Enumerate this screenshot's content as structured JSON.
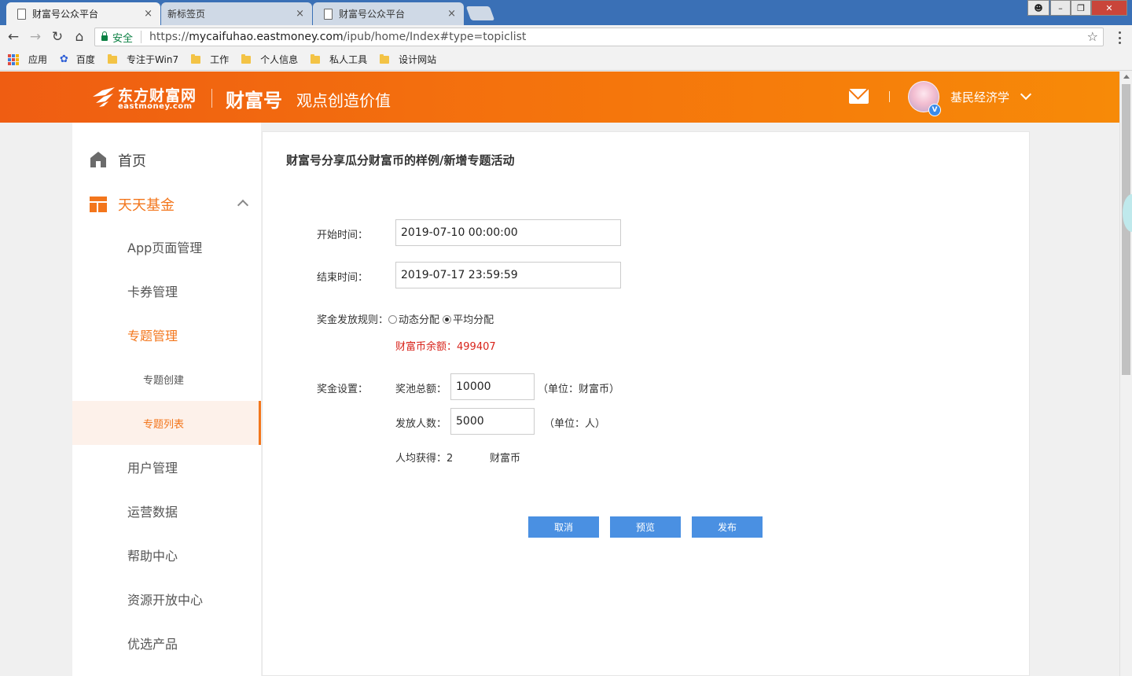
{
  "browser": {
    "tabs": [
      {
        "title": "财富号公众平台",
        "active": true
      },
      {
        "title": "新标签页",
        "active": false
      },
      {
        "title": "财富号公众平台",
        "active": false
      }
    ],
    "close_glyph": "×",
    "secure_label": "安全",
    "url_scheme": "https://",
    "url_host": "mycaifuhao.eastmoney.com",
    "url_path": "/ipub/home/Index#type=topiclist",
    "bookmarks": [
      {
        "label": "应用",
        "icon": "apps-grid-icon"
      },
      {
        "label": "百度",
        "icon": "baidu-paw-icon"
      },
      {
        "label": "专注于Win7",
        "icon": "folder-icon"
      },
      {
        "label": "工作",
        "icon": "folder-icon"
      },
      {
        "label": "个人信息",
        "icon": "folder-icon"
      },
      {
        "label": "私人工具",
        "icon": "folder-icon"
      },
      {
        "label": "设计网站",
        "icon": "folder-icon"
      }
    ]
  },
  "header": {
    "logo_cn": "东方财富网",
    "logo_en": "eastmoney.com",
    "brand": "财富号",
    "slogan": "观点创造价值",
    "user_name": "基民经济学",
    "verified_badge": "V",
    "accent": "#f5760c"
  },
  "sidebar": {
    "home": "首页",
    "fund": "天天基金",
    "items": [
      {
        "label": "App页面管理"
      },
      {
        "label": "卡券管理"
      },
      {
        "label": "专题管理",
        "active_group": true
      },
      {
        "label": "专题创建"
      },
      {
        "label": "专题列表",
        "selected": true
      },
      {
        "label": "用户管理"
      },
      {
        "label": "运营数据"
      },
      {
        "label": "帮助中心"
      },
      {
        "label": "资源开放中心"
      },
      {
        "label": "优选产品"
      }
    ]
  },
  "form": {
    "title": "财富号分享瓜分财富币的样例/新增专题活动",
    "start_label": "开始时间：",
    "start_value": "2019-07-10 00:00:00",
    "end_label": "结束时间：",
    "end_value": "2019-07-17 23:59:59",
    "rule_label": "奖金发放规则：",
    "rule_options": [
      "动态分配",
      "平均分配"
    ],
    "rule_selected": "平均分配",
    "balance_text": "财富币余额：499407",
    "prize_label": "奖金设置：",
    "pool_label": "奖池总额：",
    "pool_value": "10000",
    "pool_unit": "（单位：财富币）",
    "count_label": "发放人数：",
    "count_value": "5000",
    "count_unit": "（单位：人）",
    "avg_label": "人均获得：2",
    "avg_unit": "财富币",
    "buttons": {
      "cancel": "取消",
      "preview": "预览",
      "publish": "发布"
    },
    "button_color": "#4a90e2",
    "balance_color": "#d8231a"
  }
}
